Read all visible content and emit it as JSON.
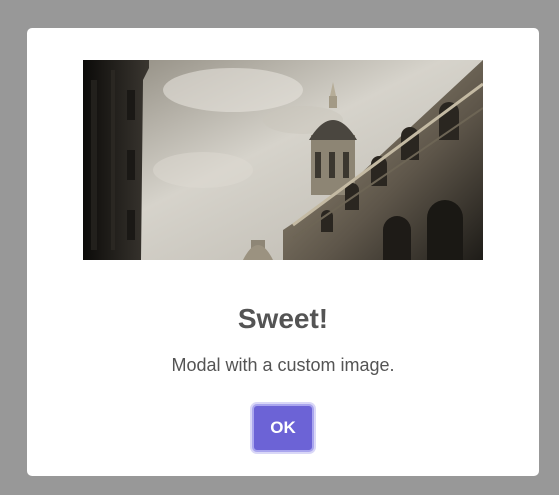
{
  "modal": {
    "title": "Sweet!",
    "text": "Modal with a custom image.",
    "confirm_label": "OK",
    "image_icon": "custom-image",
    "colors": {
      "backdrop": "#989898",
      "panel": "#ffffff",
      "text": "#545454",
      "confirm_button": "#6c63d6",
      "confirm_focus_ring": "#aaa6ee"
    }
  }
}
